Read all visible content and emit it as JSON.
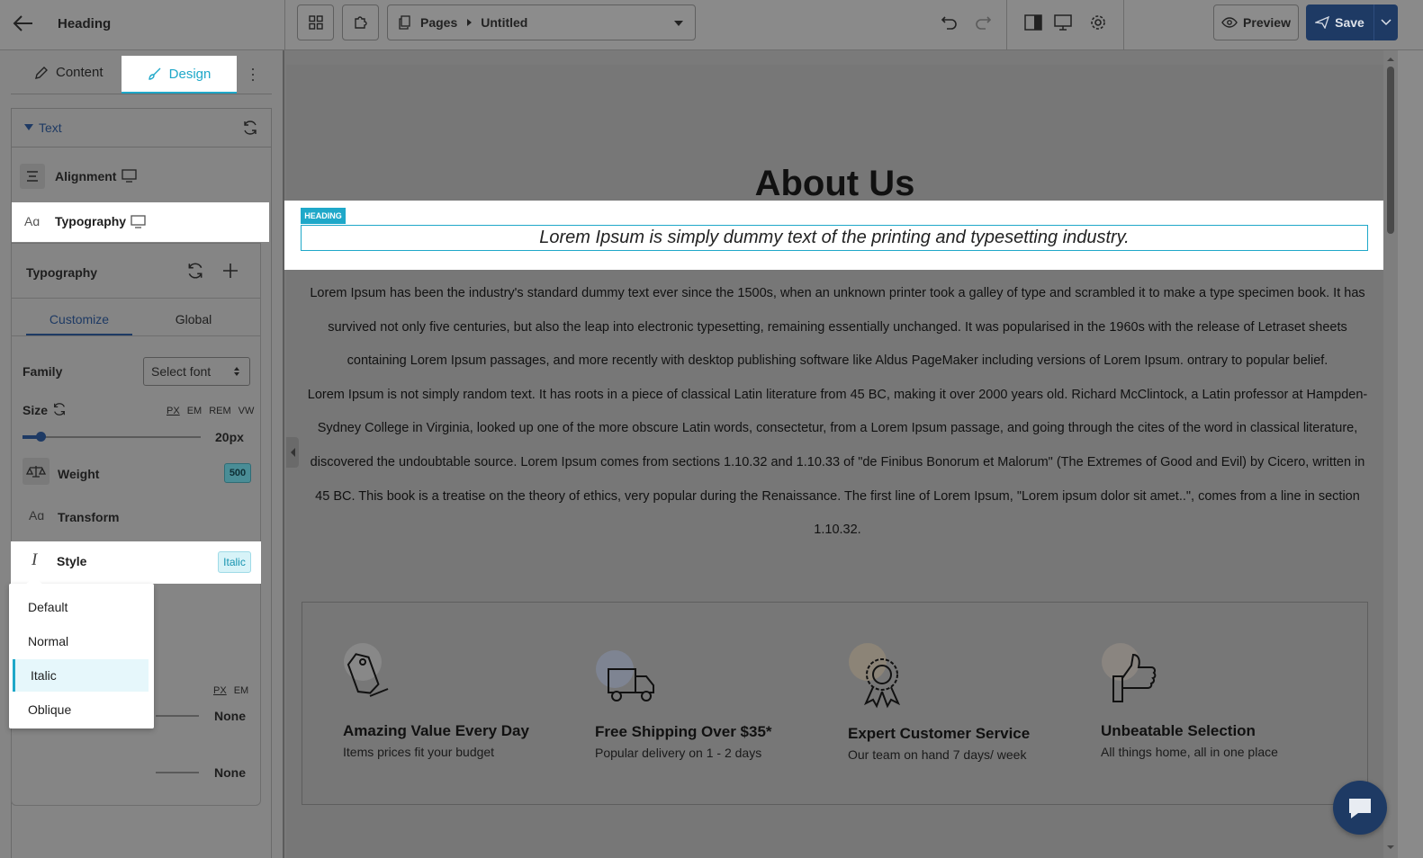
{
  "header": {
    "title": "Heading",
    "breadcrumb_root": "Pages",
    "breadcrumb_page": "Untitled",
    "preview_label": "Preview",
    "save_label": "Save"
  },
  "panel": {
    "tabs": {
      "content": "Content",
      "design": "Design"
    },
    "section_text": "Text",
    "alignment_label": "Alignment",
    "typography_label": "Typography"
  },
  "typography": {
    "title": "Typography",
    "tab_customize": "Customize",
    "tab_global": "Global",
    "family_label": "Family",
    "family_value": "Select font",
    "size_label": "Size",
    "units": [
      "PX",
      "EM",
      "REM",
      "VW"
    ],
    "size_value": "20px",
    "size_slider_fraction": 0.1,
    "weight_label": "Weight",
    "weight_value": "500",
    "transform_label": "Transform",
    "style_label": "Style",
    "style_value": "Italic",
    "lower_units": [
      "PX",
      "EM"
    ],
    "none_1": "None",
    "none_2": "None"
  },
  "style_menu": {
    "options": [
      "Default",
      "Normal",
      "Italic",
      "Oblique"
    ],
    "selected": "Italic"
  },
  "page": {
    "heading": "About Us",
    "badge": "HEADING",
    "subheading": "Lorem Ipsum is simply dummy text of the printing and typesetting industry.",
    "para_lines": [
      "Lorem Ipsum has been the industry's standard dummy text ever since the 1500s, when an unknown printer took a galley of type and scrambled it to make a type specimen book. It has",
      "survived not only five centuries, but also the leap into electronic typesetting, remaining essentially unchanged. It was popularised in the 1960s with the release of Letraset sheets",
      "containing Lorem Ipsum passages, and more recently with desktop publishing software like Aldus PageMaker including versions of Lorem Ipsum. ontrary to popular belief.",
      "Lorem Ipsum is not simply random text. It has roots in a piece of classical Latin literature from 45 BC, making it over 2000 years old. Richard McClintock, a Latin professor at Hampden-",
      "Sydney College in Virginia, looked up one of the more obscure Latin words, consectetur, from a Lorem Ipsum passage, and going through the cites of the word in classical literature,",
      "discovered the undoubtable source. Lorem Ipsum comes from sections 1.10.32 and 1.10.33 of \"de Finibus Bonorum et Malorum\" (The Extremes of Good and Evil) by Cicero, written in",
      "45 BC. This book is a treatise on the theory of ethics, very popular during the Renaissance. The first line of Lorem Ipsum, \"Lorem ipsum dolor sit amet..\", comes from a line in section",
      "1.10.32."
    ],
    "features": [
      {
        "title": "Amazing Value Every Day",
        "sub": "Items prices fit your budget",
        "icon": "price-tag-icon"
      },
      {
        "title": "Free Shipping Over $35*",
        "sub": "Popular delivery on 1 - 2 days",
        "icon": "truck-icon"
      },
      {
        "title": "Expert Customer Service",
        "sub": "Our team on hand 7 days/ week",
        "icon": "award-ribbon-icon"
      },
      {
        "title": "Unbeatable Selection",
        "sub": "All things home, all in one place",
        "icon": "thumbs-up-icon"
      }
    ]
  },
  "colors": {
    "accent": "#1fa8c9",
    "save": "#1e3a64",
    "overlay": "#777777"
  }
}
